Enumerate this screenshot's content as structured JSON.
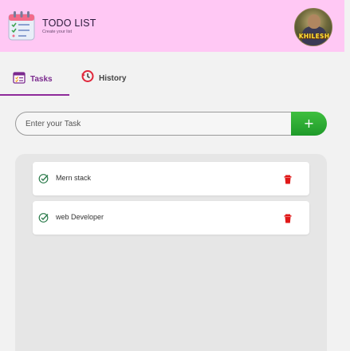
{
  "header": {
    "title": "TODO LIST",
    "subtitle": "Create your list",
    "avatar_name": "KHILESH",
    "background": "#ffc8f4"
  },
  "tabs": [
    {
      "label": "Tasks",
      "icon": "calendar-checklist-icon",
      "active": true
    },
    {
      "label": "History",
      "icon": "history-icon",
      "active": false
    }
  ],
  "input": {
    "placeholder": "Enter your Task",
    "value": "",
    "add_label": "+"
  },
  "tasks": [
    {
      "text": "Mern stack",
      "check_icon": "check-circle-icon",
      "delete_icon": "trash-icon"
    },
    {
      "text": "web Developer",
      "check_icon": "check-circle-icon",
      "delete_icon": "trash-icon"
    }
  ],
  "colors": {
    "accent": "#8e2a9a",
    "add_button": "#1f9a2a",
    "delete": "#e01818",
    "check": "#2a8a4a"
  }
}
